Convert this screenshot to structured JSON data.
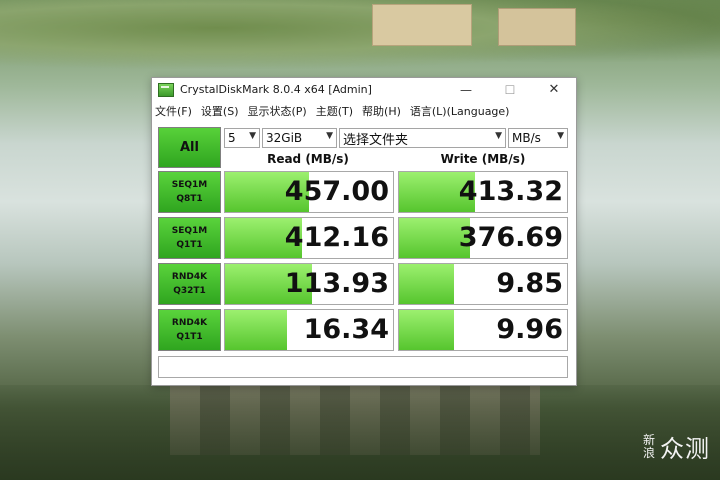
{
  "window": {
    "title": "CrystalDiskMark 8.0.4 x64 [Admin]",
    "controls": {
      "minimize": "—",
      "maximize": "☐",
      "close": "✕"
    }
  },
  "menu": [
    "文件(F)",
    "设置(S)",
    "显示状态(P)",
    "主题(T)",
    "帮助(H)",
    "语言(L)(Language)"
  ],
  "toolbar": {
    "all_label": "All",
    "count": "5",
    "size": "32GiB",
    "folder": "选择文件夹",
    "unit": "MB/s"
  },
  "headers": {
    "read": "Read (MB/s)",
    "write": "Write (MB/s)"
  },
  "tests": [
    {
      "line1": "SEQ1M",
      "line2": "Q8T1",
      "read": "457.00",
      "write": "413.32",
      "read_fill": 0.5,
      "write_fill": 0.45
    },
    {
      "line1": "SEQ1M",
      "line2": "Q1T1",
      "read": "412.16",
      "write": "376.69",
      "read_fill": 0.46,
      "write_fill": 0.42
    },
    {
      "line1": "RND4K",
      "line2": "Q32T1",
      "read": "113.93",
      "write": "9.85",
      "read_fill": 0.52,
      "write_fill": 0.33
    },
    {
      "line1": "RND4K",
      "line2": "Q1T1",
      "read": "16.34",
      "write": "9.96",
      "read_fill": 0.37,
      "write_fill": 0.33
    }
  ],
  "comment": "",
  "watermark": {
    "small": "新浪",
    "big": "众测"
  },
  "colors": {
    "accent_green": "#3fb827",
    "bar_green": "#7ddc4f"
  }
}
